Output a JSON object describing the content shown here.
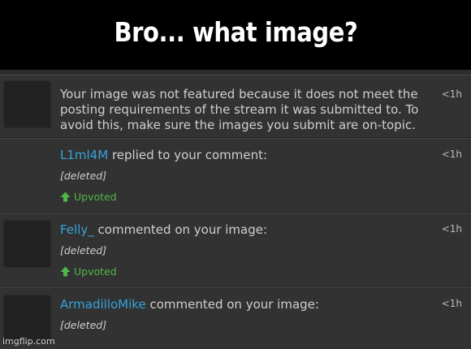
{
  "caption": "Bro... what image?",
  "notifications": [
    {
      "message": "Your image was not featured because it does not meet the posting requirements of the stream it was submitted to. To avoid this, make sure the images you submit are on-topic.",
      "time": "<1h"
    },
    {
      "user": "L1ml4M",
      "action": "replied to your comment:",
      "content": "[deleted]",
      "status": "Upvoted",
      "time": "<1h"
    },
    {
      "user": "Felly_",
      "action": "commented on your image:",
      "content": "[deleted]",
      "status": "Upvoted",
      "time": "<1h"
    },
    {
      "user": "ArmadilloMike",
      "action": "commented on your image:",
      "content": "[deleted]",
      "time": "<1h"
    }
  ],
  "watermark": "imgflip.com",
  "colors": {
    "username": "#34a4dc",
    "upvoted": "#4fb848",
    "background": "#323232"
  },
  "icons": {
    "upvote": "up-arrow-icon"
  }
}
